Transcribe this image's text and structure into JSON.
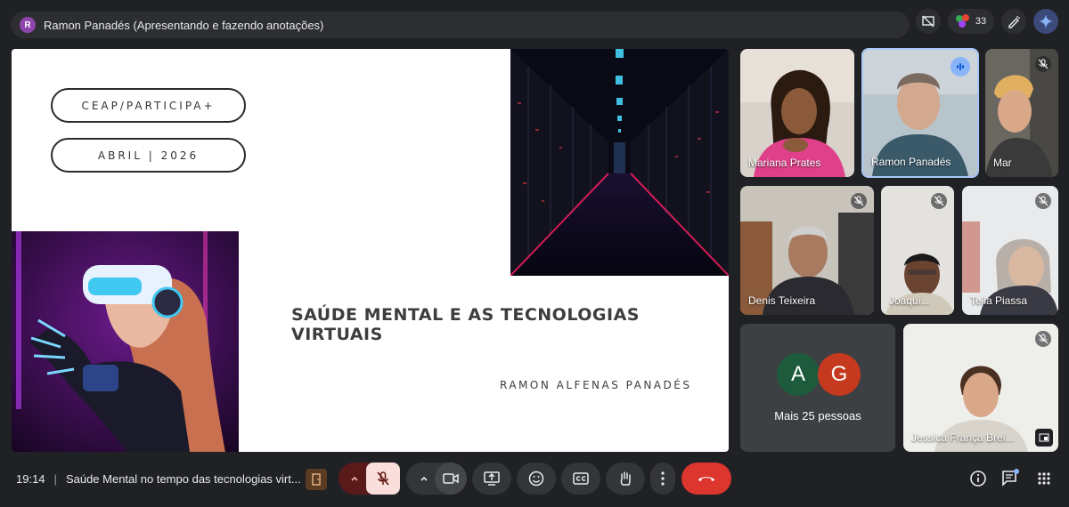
{
  "presenter_bar": {
    "avatar_letter": "R",
    "text": "Ramon Panadés (Apresentando e fazendo anotações)"
  },
  "top_right": {
    "people_count": "33"
  },
  "slide": {
    "pill1": "CEAP/PARTICIPA+",
    "pill2": "ABRIL | 2026",
    "title": "SAÚDE MENTAL E AS TECNOLOGIAS VIRTUAIS",
    "author": "RAMON ALFENAS PANADÉS"
  },
  "participants": [
    {
      "name": "Mariana Prates"
    },
    {
      "name": "Ramon Panadés"
    },
    {
      "name": "Mar"
    },
    {
      "name": "Denis Teixeira"
    },
    {
      "name": "Joaqui..."
    },
    {
      "name": "Teila Piassa"
    },
    {
      "name": "Jessica França Brei..."
    }
  ],
  "more_tile": {
    "avatar_a": "A",
    "avatar_g": "G",
    "label": "Mais 25 pessoas",
    "color_a": "#1e5a3c",
    "color_g": "#c5391e"
  },
  "bottom": {
    "time": "19:14",
    "meeting_title": "Saúde Mental no tempo das tecnologias virt..."
  },
  "colors": {
    "accent": "#a8c7fa",
    "end_call": "#dc362e",
    "background": "#202124"
  }
}
